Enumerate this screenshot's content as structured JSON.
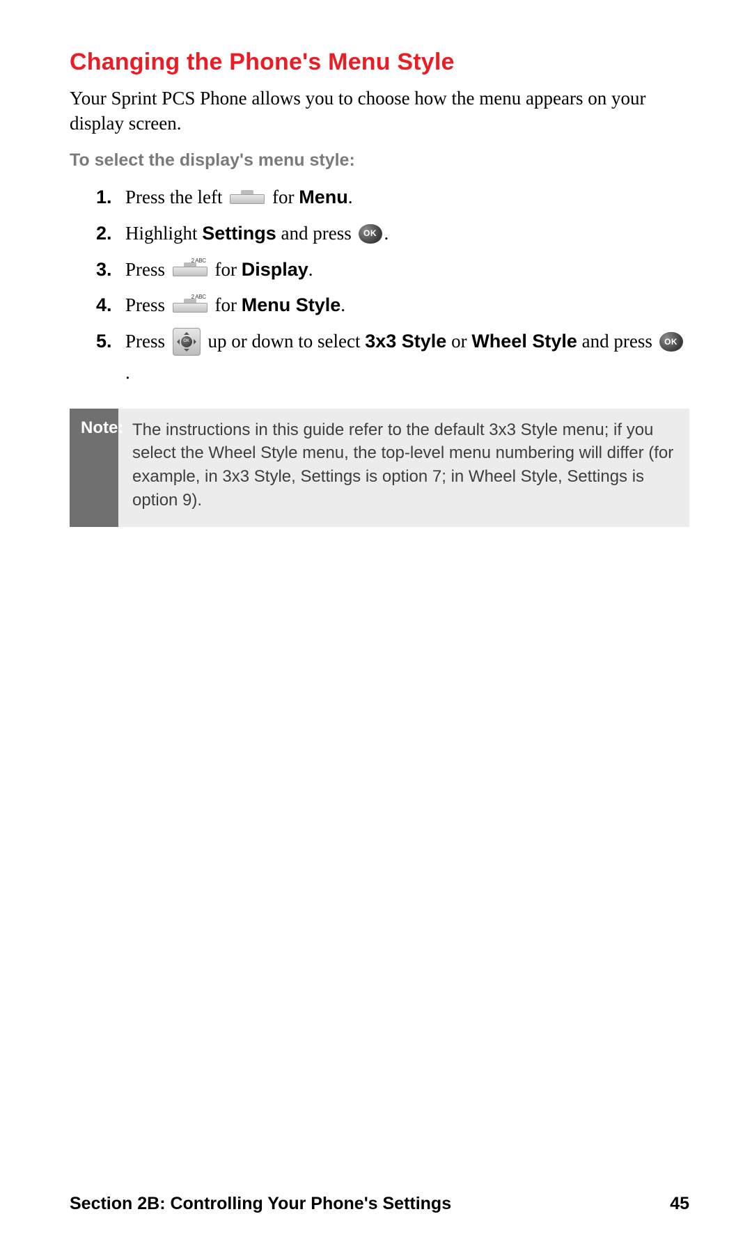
{
  "title": "Changing the Phone's Menu Style",
  "intro": "Your Sprint PCS Phone allows you to choose how the menu appears on your display screen.",
  "lead": "To select the display's menu style:",
  "steps": {
    "s1": {
      "num": "1.",
      "a": "Press the left ",
      "b": " for ",
      "bold": "Menu",
      "end": "."
    },
    "s2": {
      "num": "2.",
      "a": "Highlight ",
      "bold1": "Settings",
      "b": " and press ",
      "end": "."
    },
    "s3": {
      "num": "3.",
      "a": "Press ",
      "b": " for ",
      "bold": "Display",
      "end": ".",
      "key_label": "2 ABC"
    },
    "s4": {
      "num": "4.",
      "a": "Press ",
      "b": " for ",
      "bold": "Menu Style",
      "end": ".",
      "key_label": "2 ABC"
    },
    "s5": {
      "num": "5.",
      "a": "Press ",
      "b": " up or down to select ",
      "bold1": "3x3 Style",
      "c": " or ",
      "bold2": "Wheel Style",
      "d": " and press ",
      "end": "."
    }
  },
  "ok_label": "OK",
  "note": {
    "label": "Note:",
    "text": "The instructions in this guide refer to the default 3x3 Style menu; if you select the Wheel Style menu, the top-level menu numbering will differ (for example, in 3x3 Style, Settings is option 7; in Wheel Style, Settings is option 9)."
  },
  "footer": {
    "section": "Section 2B: Controlling Your Phone's Settings",
    "page": "45"
  }
}
